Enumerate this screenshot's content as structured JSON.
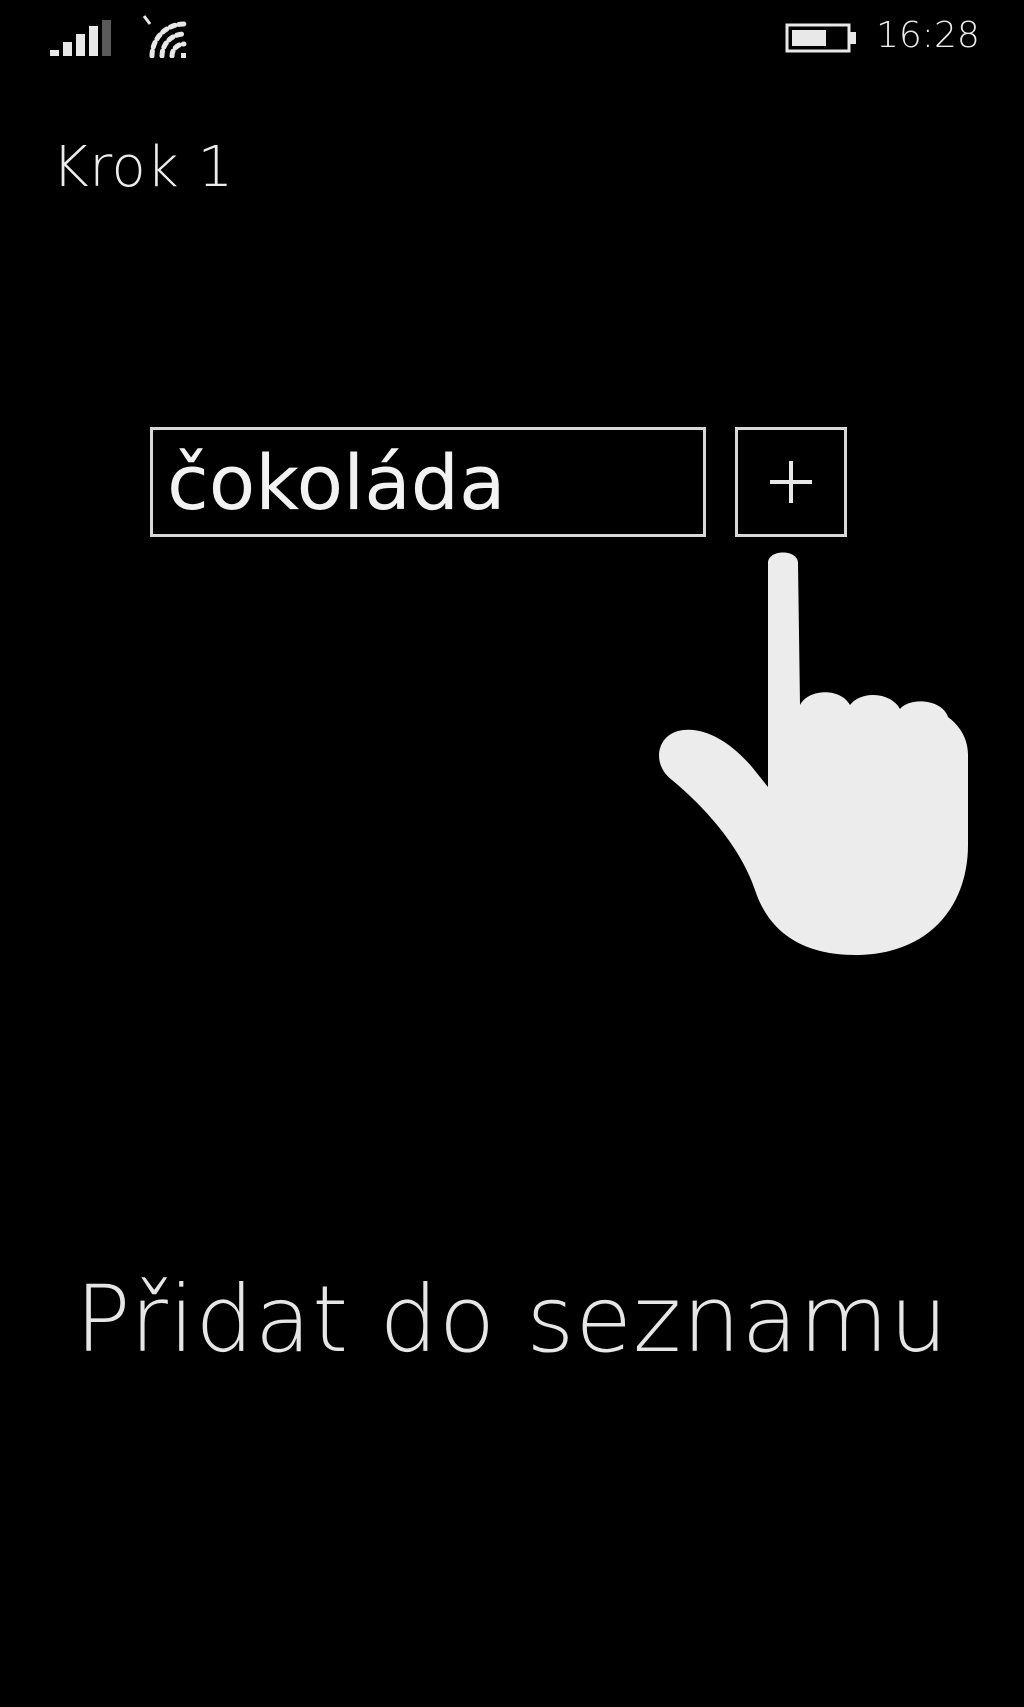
{
  "status_bar": {
    "icons": [
      "signal-icon",
      "wifi-icon",
      "battery-icon"
    ],
    "time": "16:28"
  },
  "page": {
    "title": "Krok 1"
  },
  "input": {
    "value": "čokoláda"
  },
  "add_button": {
    "icon": "plus-icon"
  },
  "gesture": {
    "icon": "hand-pointer-icon"
  },
  "caption": "Přidat do seznamu",
  "colors": {
    "background": "#000000",
    "foreground": "#ececec",
    "border": "#d8d8d8"
  }
}
